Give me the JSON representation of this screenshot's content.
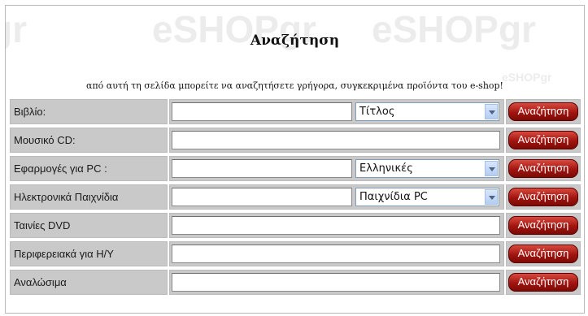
{
  "header": {
    "title": "Αναζήτηση",
    "subtitle": "από αυτή τη σελίδα μπορείτε να αναζητήσετε γρήγορα, συγκεκριμένα προϊόντα του e-shop!"
  },
  "watermark": {
    "brand": "eSHOP",
    "suffix": "gr"
  },
  "search_button_label": "Αναζήτηση",
  "rows": [
    {
      "label": "Βιβλίο:",
      "select": "Τίτλος"
    },
    {
      "label": "Μουσικό CD:"
    },
    {
      "label": "Εφαρμογές για PC :",
      "select": "Ελληνικές"
    },
    {
      "label": "Ηλεκτρονικά Παιχνίδια",
      "select": "Παιχνίδια PC"
    },
    {
      "label": "Ταινίες DVD"
    },
    {
      "label": "Περιφερειακά για Η/Υ"
    },
    {
      "label": "Αναλώσιμα"
    }
  ],
  "colors": {
    "button": "#a1140f",
    "label_bg": "#c9c9c9",
    "select_border": "#7f9db9"
  }
}
